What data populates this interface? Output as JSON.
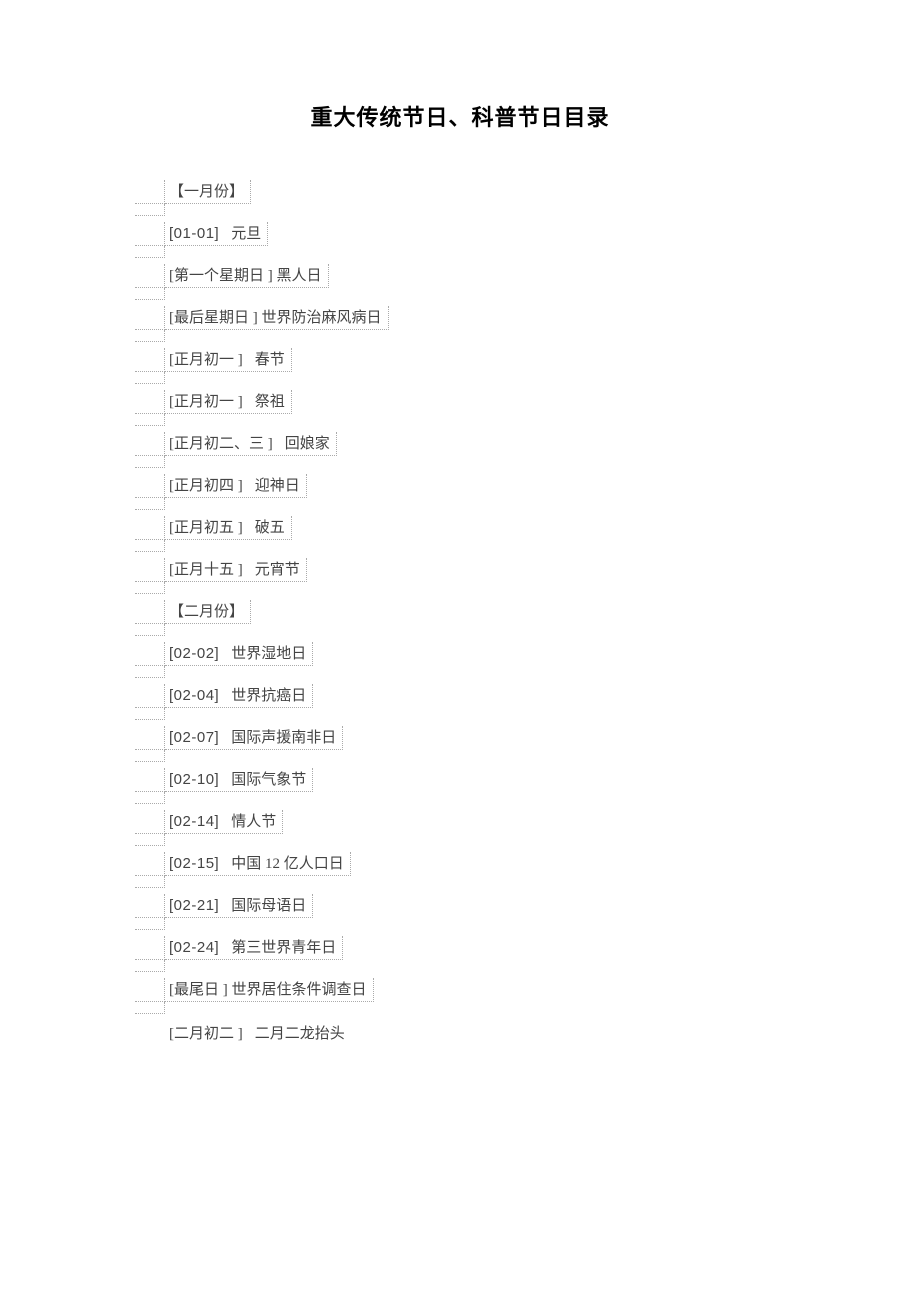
{
  "title": "重大传统节日、科普节日目录",
  "rows": [
    {
      "date": "【一月份】",
      "name": ""
    },
    {
      "date": "[01-01]",
      "name": "元旦"
    },
    {
      "date": "[第一个星期日  ]",
      "name": "黑人日",
      "nogap": true
    },
    {
      "date": "[最后星期日 ]",
      "name": "世界防治麻风病日",
      "nogap": true
    },
    {
      "date": "[正月初一  ]",
      "name": "春节"
    },
    {
      "date": "[正月初一  ]",
      "name": "祭祖"
    },
    {
      "date": "[正月初二、三  ]",
      "name": "回娘家"
    },
    {
      "date": "[正月初四  ]",
      "name": "迎神日"
    },
    {
      "date": "[正月初五  ]",
      "name": "破五"
    },
    {
      "date": "[正月十五  ]",
      "name": "元宵节"
    },
    {
      "date": "【二月份】",
      "name": ""
    },
    {
      "date": "[02-02]",
      "name": "世界湿地日"
    },
    {
      "date": "[02-04]",
      "name": "世界抗癌日"
    },
    {
      "date": "[02-07]",
      "name": "国际声援南非日"
    },
    {
      "date": "[02-10]",
      "name": "国际气象节"
    },
    {
      "date": "[02-14]",
      "name": "情人节"
    },
    {
      "date": "[02-15]",
      "name": "中国 12 亿人口日"
    },
    {
      "date": "[02-21]",
      "name": "国际母语日"
    },
    {
      "date": "[02-24]",
      "name": "第三世界青年日"
    },
    {
      "date": "[最尾日 ]",
      "name": "世界居住条件调查日",
      "nogap": true
    },
    {
      "date": "[二月初二  ]",
      "name": "二月二龙抬头",
      "last": true
    }
  ]
}
